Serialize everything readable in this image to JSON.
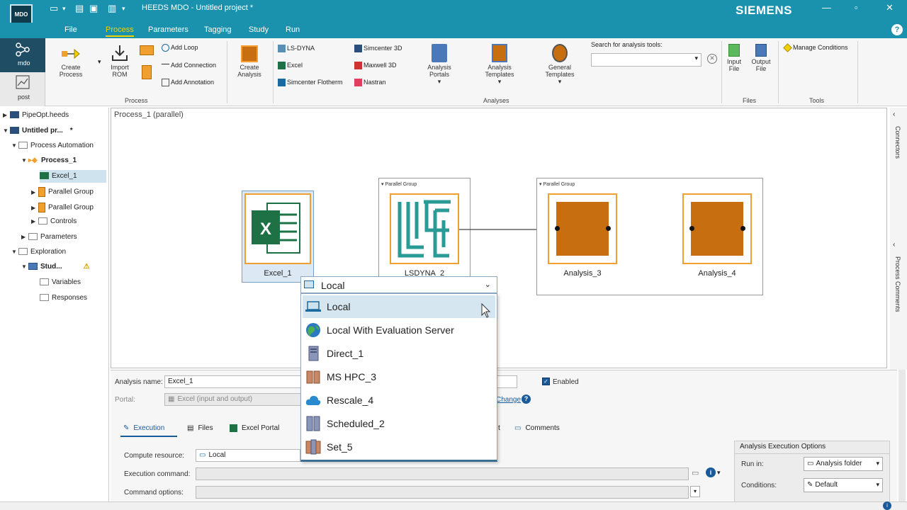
{
  "titlebar": {
    "logo_label": "MDO",
    "title": "HEEDS MDO - Untitled project *",
    "brand": "SIEMENS"
  },
  "menu": {
    "tabs": [
      "File",
      "Process",
      "Parameters",
      "Tagging",
      "Study",
      "Run"
    ],
    "active_tab": "Process",
    "help": "?"
  },
  "modes": {
    "mdo": "mdo",
    "post": "post"
  },
  "ribbon": {
    "process": {
      "group_label": "Process",
      "create_process": "Create\nProcess",
      "import_rom": "Import\nROM",
      "add_loop": "Add Loop",
      "add_connection": "Add Connection",
      "add_annotation": "Add Annotation",
      "create_analysis": "Create\nAnalysis"
    },
    "analyses": {
      "group_label": "Analyses",
      "ls_dyna": "LS-DYNA",
      "excel": "Excel",
      "simcenter_flotherm": "Simcenter Flotherm",
      "simcenter_3d": "Simcenter 3D",
      "maxwell_3d": "Maxwell 3D",
      "nastran": "Nastran",
      "analysis_portals": "Analysis\nPortals",
      "analysis_templates": "Analysis\nTemplates",
      "general_templates": "General\nTemplates",
      "search_label": "Search for analysis tools:",
      "search_value": ""
    },
    "files": {
      "group_label": "Files",
      "input_file": "Input\nFile",
      "output_file": "Output\nFile"
    },
    "tools": {
      "group_label": "Tools",
      "manage_conditions": "Manage Conditions"
    }
  },
  "tree": {
    "items": [
      {
        "label": "PipeOpt.heeds"
      },
      {
        "label": "Untitled pr...",
        "mark": "*"
      },
      {
        "label": "Process Automation"
      },
      {
        "label": "Process_1"
      },
      {
        "label": "Excel_1"
      },
      {
        "label": "Parallel Group"
      },
      {
        "label": "Parallel Group"
      },
      {
        "label": "Controls"
      },
      {
        "label": "Parameters"
      },
      {
        "label": "Exploration"
      },
      {
        "label": "Stud...",
        "mark": "⚠"
      },
      {
        "label": "Variables"
      },
      {
        "label": "Responses"
      }
    ]
  },
  "canvas": {
    "title": "Process_1 (parallel)",
    "parallel_group_label": "Parallel Group",
    "nodes": {
      "excel": "Excel_1",
      "lsdyna": "LSDYNA_2",
      "analysis3": "Analysis_3",
      "analysis4": "Analysis_4"
    }
  },
  "rightrail": {
    "connectors": "Connectors",
    "process_comments": "Process Comments"
  },
  "bottom": {
    "analysis_name_label": "Analysis name:",
    "analysis_name_value": "Excel_1",
    "enabled_label": "Enabled",
    "portal_label": "Portal:",
    "portal_value": "Excel (input and output)",
    "change_link": "Change",
    "tabs": [
      "Execution",
      "Files",
      "Excel Portal",
      "t",
      "Comments"
    ],
    "compute_resource_label": "Compute resource:",
    "compute_resource_value": "Local",
    "execution_command_label": "Execution command:",
    "command_options_label": "Command options:",
    "options": {
      "title": "Analysis Execution Options",
      "run_in_label": "Run in:",
      "run_in_value": "Analysis folder",
      "conditions_label": "Conditions:",
      "conditions_value": "Default"
    }
  },
  "dropdown": {
    "selected": "Local",
    "items": [
      "Local",
      "Local With Evaluation Server",
      "Direct_1",
      "MS HPC_3",
      "Rescale_4",
      "Scheduled_2",
      "Set_5"
    ]
  }
}
